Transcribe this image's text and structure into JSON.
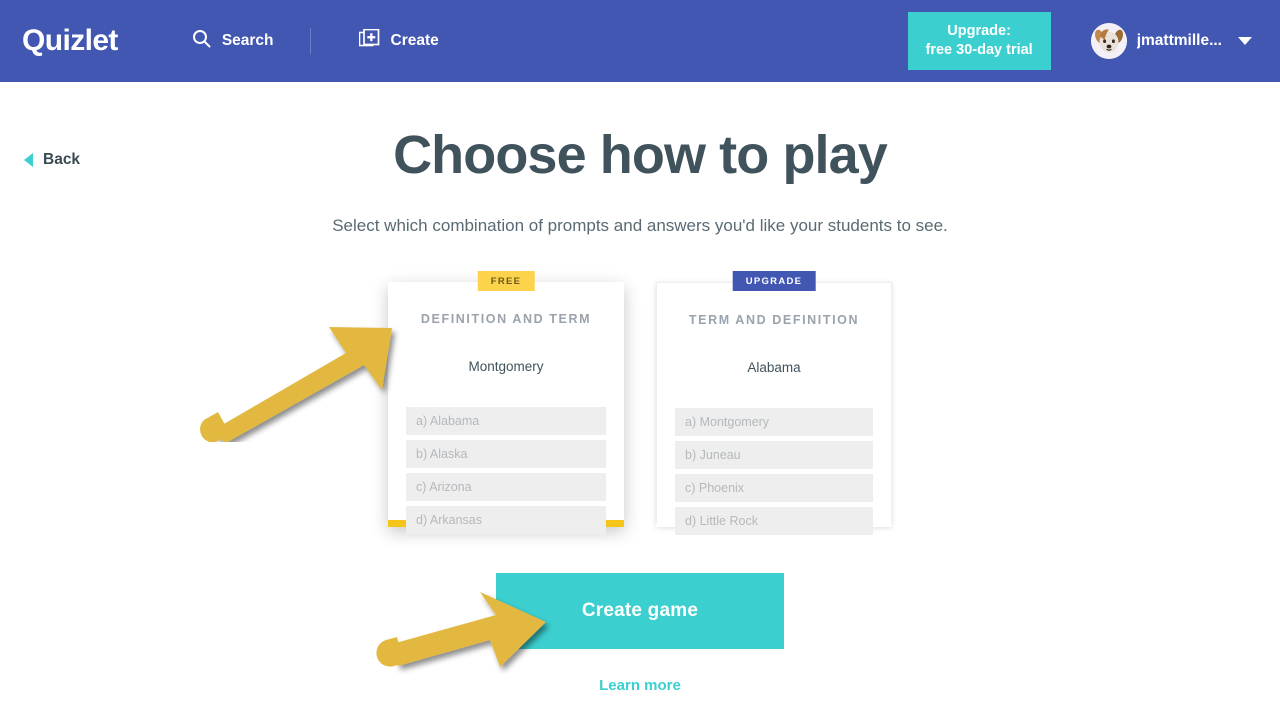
{
  "header": {
    "logo": "Quizlet",
    "nav": [
      {
        "label": "Search",
        "icon": "search-icon"
      },
      {
        "label": "Create",
        "icon": "create-card-icon"
      }
    ],
    "upgrade_button": {
      "line1": "Upgrade:",
      "line2": "free 30-day trial",
      "bg_color": "#3ccfcf"
    },
    "user": {
      "name": "jmattmille...",
      "avatar": "dog-photo-avatar"
    },
    "bg_color": "#4257b2"
  },
  "back": {
    "label": "Back",
    "icon": "chevron-left-icon"
  },
  "main": {
    "title": "Choose how to play",
    "subtitle": "Select which combination of prompts and answers you'd like your students to see.",
    "cards": [
      {
        "badge": "FREE",
        "badge_type": "free",
        "badge_color": "#fcd34a",
        "type_label": "DEFINITION AND TERM",
        "prompt": "Montgomery",
        "choices": [
          "a) Alabama",
          "b) Alaska",
          "c) Arizona",
          "d) Arkansas"
        ],
        "selected": true,
        "accent_color": "#f5c518"
      },
      {
        "badge": "UPGRADE",
        "badge_type": "upgrade",
        "badge_color": "#4257b2",
        "type_label": "TERM AND DEFINITION",
        "prompt": "Alabama",
        "choices": [
          "a) Montgomery",
          "b) Juneau",
          "c) Phoenix",
          "d) Little Rock"
        ],
        "selected": false,
        "accent_color": "#ffffff"
      }
    ],
    "create_game_button": "Create game",
    "learn_more": "Learn more"
  },
  "annotations": {
    "arrow_color": "#e3b83f",
    "arrows": [
      {
        "name": "arrow-pointing-to-definition-and-term-card",
        "direction": "up-right"
      },
      {
        "name": "arrow-pointing-to-create-game-button",
        "direction": "right"
      }
    ]
  }
}
